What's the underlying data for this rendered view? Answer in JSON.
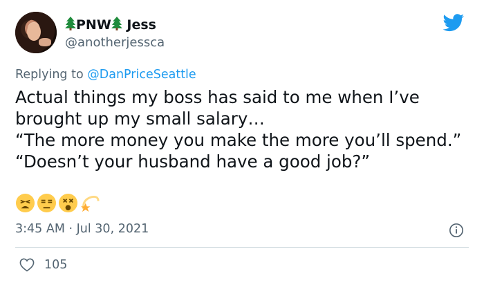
{
  "tweet": {
    "display_name_part1": "PNW",
    "display_name_part2": "Jess",
    "handle": "@anotherjessca",
    "replying_prefix": "Replying to",
    "replying_to": "@DanPriceSeattle",
    "body_lines": [
      "Actual things my boss has said to me when I’ve brought up my small salary…",
      "“The more money you make the more you’ll spend.”",
      "“Doesn’t your husband have a good job?”"
    ],
    "emojis": [
      "tired-face-emoji",
      "unamused-face-emoji",
      "dizzy-face-emoji",
      "dizzy-star-emoji"
    ],
    "timestamp": "3:45 AM · Jul 30, 2021",
    "like_count": "105"
  },
  "icons": {
    "brand": "twitter-bird-icon",
    "info": "info-icon",
    "like": "heart-icon",
    "name_decoration": "evergreen-tree-icon"
  },
  "colors": {
    "accent": "#1d9bf0",
    "secondary_text": "#536471",
    "tree": "#1f8c3c",
    "divider": "#cfd9de"
  }
}
